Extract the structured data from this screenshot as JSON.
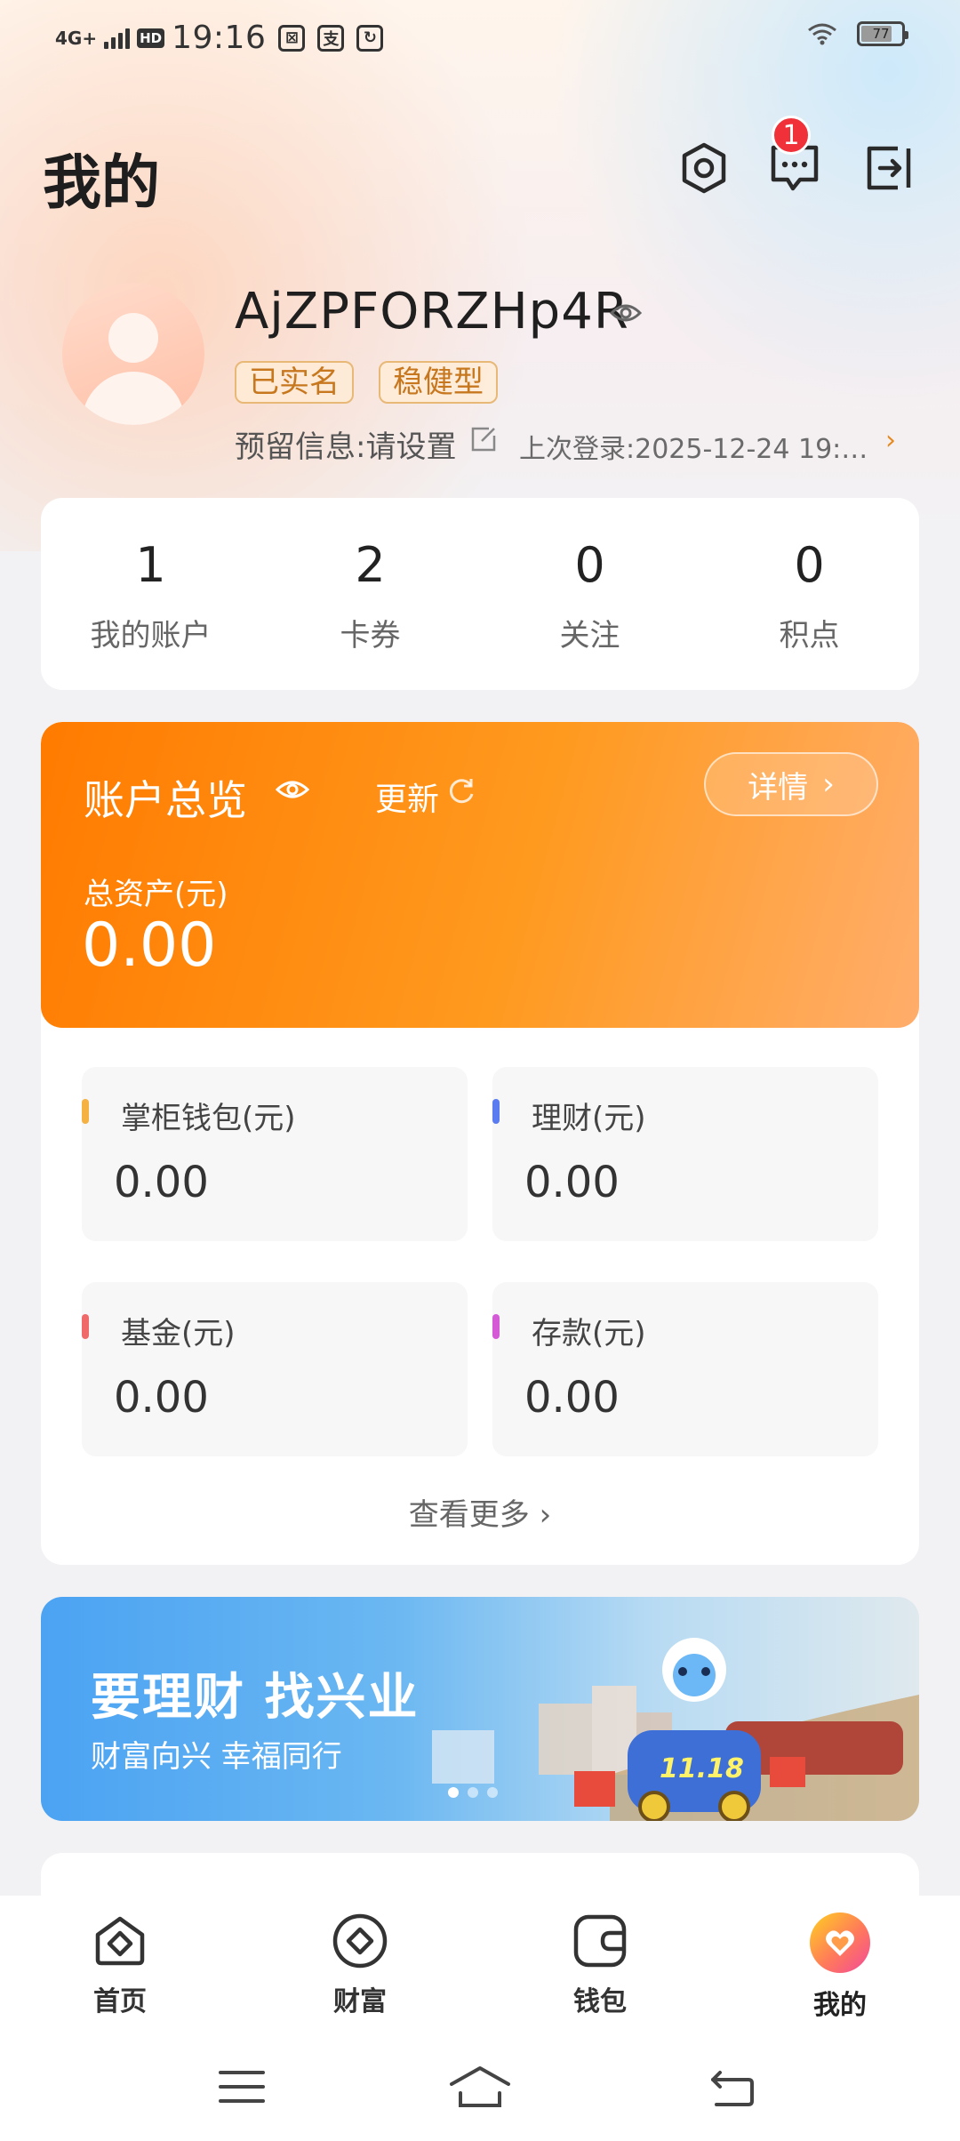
{
  "status_bar": {
    "network": "4G+",
    "hd": "HD",
    "time": "19:16",
    "battery": "77",
    "battery_level": 0.77
  },
  "header": {
    "title": "我的",
    "message_badge": "1"
  },
  "profile": {
    "username": "AjZPFORZHp4R",
    "tags": [
      "已实名",
      "稳健型"
    ],
    "reserved_info": "预留信息:请设置",
    "last_login": "上次登录:2025-12-24 19:0…"
  },
  "stats": [
    {
      "value": "1",
      "label": "我的账户"
    },
    {
      "value": "2",
      "label": "卡券"
    },
    {
      "value": "0",
      "label": "关注"
    },
    {
      "value": "0",
      "label": "积点"
    }
  ],
  "overview": {
    "title": "账户总览",
    "update_label": "更新",
    "detail_label": "详情",
    "total_label": "总资产(元)",
    "total_value": "0.00",
    "assets": [
      {
        "label": "掌柜钱包(元)",
        "value": "0.00",
        "color": "#f5b142"
      },
      {
        "label": "理财(元)",
        "value": "0.00",
        "color": "#5b7cf0"
      },
      {
        "label": "基金(元)",
        "value": "0.00",
        "color": "#f06a6a"
      },
      {
        "label": "存款(元)",
        "value": "0.00",
        "color": "#d45ad6"
      }
    ],
    "see_more": "查看更多 ›"
  },
  "banner": {
    "title": "要理财 找兴业",
    "subtitle": "财富向兴 幸福同行",
    "badge_text": "11.18"
  },
  "tabbar": [
    {
      "label": "首页",
      "icon": "home-icon"
    },
    {
      "label": "财富",
      "icon": "wealth-icon"
    },
    {
      "label": "钱包",
      "icon": "wallet-icon"
    },
    {
      "label": "我的",
      "icon": "mine-icon"
    }
  ],
  "colors": {
    "accent_orange": "#ff8a00",
    "badge_red": "#f0313a",
    "tag_text": "#c7771e"
  }
}
